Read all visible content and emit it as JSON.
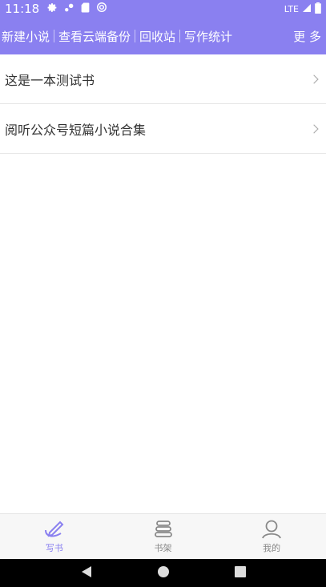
{
  "status_bar": {
    "time": "11:18",
    "network": "LTE",
    "icons": [
      "gear-icon",
      "shuffle-icon",
      "sd-card-icon",
      "sync-icon",
      "signal-icon",
      "battery-icon"
    ]
  },
  "toolbar": {
    "items": [
      {
        "label": "新建小说"
      },
      {
        "label": "查看云端备份"
      },
      {
        "label": "回收站"
      },
      {
        "label": "写作统计"
      }
    ],
    "more_label": "更 多"
  },
  "books": [
    {
      "title": "这是一本测试书"
    },
    {
      "title": "阅听公众号短篇小说合集"
    }
  ],
  "bottom_nav": {
    "items": [
      {
        "label": "写书",
        "icon": "write-book-icon",
        "active": true
      },
      {
        "label": "书架",
        "icon": "bookshelf-icon",
        "active": false
      },
      {
        "label": "我的",
        "icon": "profile-icon",
        "active": false
      }
    ]
  },
  "colors": {
    "accent": "#8a80f0",
    "nav_inactive": "#888888"
  }
}
